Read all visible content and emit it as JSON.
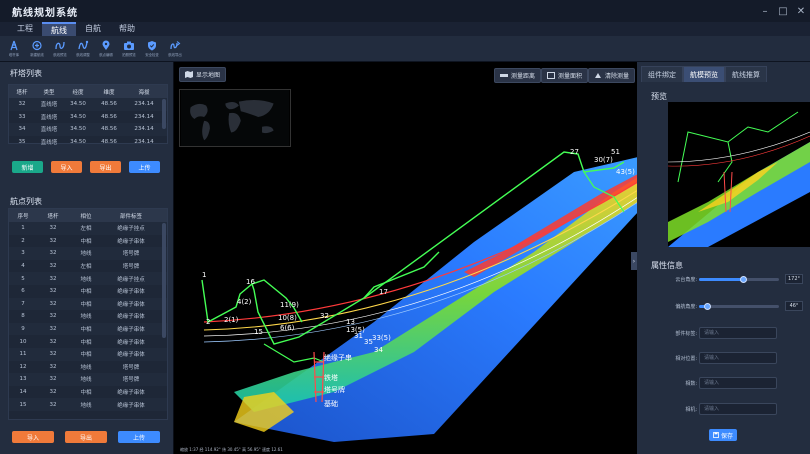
{
  "app": {
    "title": "航线规划系统"
  },
  "window": {
    "minimize": "–",
    "maximize": "□",
    "close": "✕"
  },
  "menu": [
    {
      "label": "工程",
      "active": false
    },
    {
      "label": "航线",
      "active": true
    },
    {
      "label": "自航",
      "active": false
    },
    {
      "label": "帮助",
      "active": false
    }
  ],
  "toolbar": [
    {
      "icon": "tower-select-icon",
      "label": "塔杆库"
    },
    {
      "icon": "add-route-icon",
      "label": "新建航线"
    },
    {
      "icon": "route-preview-icon",
      "label": "航线预览"
    },
    {
      "icon": "route-adjust-icon",
      "label": "航线调整"
    },
    {
      "icon": "waypoint-edit-icon",
      "label": "航点编辑"
    },
    {
      "icon": "camera-icon",
      "label": "拍照预览"
    },
    {
      "icon": "shield-icon",
      "label": "安全检查"
    },
    {
      "icon": "route-export-icon",
      "label": "航线导出"
    }
  ],
  "towers": {
    "title": "杆塔列表",
    "columns": [
      "塔杆",
      "类型",
      "经度",
      "维度",
      "海拔"
    ],
    "rows": [
      [
        "32",
        "直线塔",
        "34.50",
        "48.56",
        "234.14"
      ],
      [
        "33",
        "直线塔",
        "34.50",
        "48.56",
        "234.14"
      ],
      [
        "34",
        "直线塔",
        "34.50",
        "48.56",
        "234.14"
      ],
      [
        "35",
        "直线塔",
        "34.50",
        "48.56",
        "234.14"
      ]
    ],
    "buttons": {
      "add": "新增",
      "import": "导入",
      "export": "导出",
      "upload": "上传"
    }
  },
  "waypoints": {
    "title": "航点列表",
    "columns": [
      "序号",
      "塔杆",
      "相位",
      "部件标签"
    ],
    "rows": [
      [
        "1",
        "32",
        "左相",
        "绝缘子挂点"
      ],
      [
        "2",
        "32",
        "中相",
        "绝缘子串体"
      ],
      [
        "3",
        "32",
        "地线",
        "塔号牌"
      ],
      [
        "4",
        "32",
        "左相",
        "塔号牌"
      ],
      [
        "5",
        "32",
        "地线",
        "绝缘子挂点"
      ],
      [
        "6",
        "32",
        "中相",
        "绝缘子串体"
      ],
      [
        "7",
        "32",
        "中相",
        "绝缘子串体"
      ],
      [
        "8",
        "32",
        "地线",
        "绝缘子串体"
      ],
      [
        "9",
        "32",
        "中相",
        "绝缘子串体"
      ],
      [
        "10",
        "32",
        "中相",
        "绝缘子串体"
      ],
      [
        "11",
        "32",
        "中相",
        "绝缘子串体"
      ],
      [
        "12",
        "32",
        "地线",
        "塔号牌"
      ],
      [
        "13",
        "32",
        "地线",
        "塔号牌"
      ],
      [
        "14",
        "32",
        "中相",
        "绝缘子串体"
      ],
      [
        "15",
        "32",
        "地线",
        "绝缘子串体"
      ]
    ],
    "buttons": {
      "import": "导入",
      "export": "导出",
      "upload": "上传"
    }
  },
  "viewport": {
    "show_map": "显示地图",
    "measure_distance": "测量距离",
    "measure_area": "测量面积",
    "clear_measure": "清除测量",
    "status": "缩放 1:37   经 114.92°   纬 30.45°   高 56.95°   速度 12.61"
  },
  "right": {
    "tabs": [
      {
        "label": "组件绑定",
        "active": false
      },
      {
        "label": "航模预览",
        "active": true
      },
      {
        "label": "航线推算",
        "active": false
      }
    ],
    "preview_title": "预览",
    "props_title": "属性信息",
    "gimbal_label": "云台角度:",
    "gimbal_value": "172°",
    "gimbal_level": 0.55,
    "yaw_label": "偏航角度:",
    "yaw_value": "46°",
    "yaw_level": 0.1,
    "part_label": "部件标签:",
    "part_placeholder": "请输入",
    "relpos_label": "相对位置:",
    "relpos_placeholder": "请输入",
    "phase_label": "相数:",
    "phase_placeholder": "请输入",
    "camera_label": "相机:",
    "camera_placeholder": "请输入",
    "save": "保存"
  },
  "scene_labels": [
    "1",
    "2",
    "2(1)",
    "4(2)",
    "16",
    "11(9)",
    "10(8)",
    "6(6)",
    "15",
    "13",
    "32",
    "27",
    "51",
    "30(7)",
    "43(5)",
    "17",
    "31",
    "35",
    "33(5)",
    "34",
    "13(5)",
    "绝缘子串",
    "铁塔",
    "塔号牌",
    "基础"
  ],
  "colors": {
    "accent": "#3d8bff",
    "primary_btn": "#1aa88a",
    "orange_btn": "#f07a3a",
    "blue_btn": "#3d8bff"
  }
}
